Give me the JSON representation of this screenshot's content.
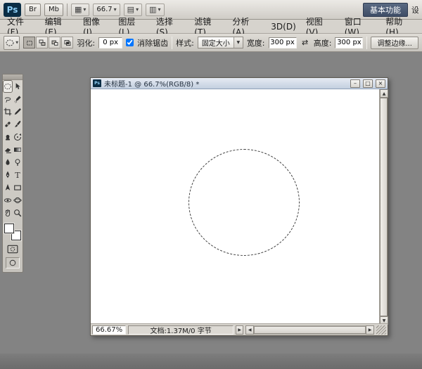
{
  "titlebar": {
    "logo": "Ps",
    "bridge": "Br",
    "mini_bridge": "Mb",
    "view_grid_icon": "▦",
    "zoom_value": "66.7",
    "arrange_icon": "▤",
    "screen_icon": "▥",
    "dropdown_icon": "▾",
    "workspace": "基本功能",
    "workspace_partial": "设"
  },
  "menubar": {
    "items": [
      "文件(F)",
      "编辑(E)",
      "图像(I)",
      "图层(L)",
      "选择(S)",
      "滤镜(T)",
      "分析(A)",
      "3D(D)",
      "视图(V)",
      "窗口(W)",
      "帮助(H)"
    ]
  },
  "options": {
    "tool_preset_dropdown": "▼",
    "feather_label": "羽化:",
    "feather_value": "0 px",
    "antialias_checked": true,
    "antialias_label": "消除锯齿",
    "style_label": "样式:",
    "style_value": "固定大小",
    "style_dropdown": "▼",
    "width_label": "宽度:",
    "width_value": "300 px",
    "swap_icon": "⇄",
    "height_label": "高度:",
    "height_value": "300 px",
    "refine_edge": "调整边缘..."
  },
  "toolbar": {
    "tools": [
      {
        "name": "elliptical-marquee-tool",
        "selected": true
      },
      {
        "name": "move-tool"
      },
      {
        "name": "lasso-tool"
      },
      {
        "name": "quick-selection-tool"
      },
      {
        "name": "crop-tool"
      },
      {
        "name": "eyedropper-tool"
      },
      {
        "name": "spot-healing-brush-tool"
      },
      {
        "name": "brush-tool"
      },
      {
        "name": "clone-stamp-tool"
      },
      {
        "name": "history-brush-tool"
      },
      {
        "name": "eraser-tool"
      },
      {
        "name": "gradient-tool"
      },
      {
        "name": "blur-tool"
      },
      {
        "name": "dodge-tool"
      },
      {
        "name": "pen-tool"
      },
      {
        "name": "type-tool"
      },
      {
        "name": "path-selection-tool"
      },
      {
        "name": "rectangle-tool"
      },
      {
        "name": "3d-rotate-tool"
      },
      {
        "name": "3d-orbit-tool"
      },
      {
        "name": "hand-tool"
      },
      {
        "name": "zoom-tool"
      }
    ],
    "foreground_color": "#ffffff",
    "background_color": "#ffffff"
  },
  "document": {
    "mini_logo": "Ps",
    "title": "未标题-1 @ 66.7%(RGB/8) *",
    "minimize_icon": "–",
    "maximize_icon": "□",
    "close_icon": "×",
    "status_zoom": "66.67%",
    "status_info": "文档:1.37M/0 字节",
    "status_popup_icon": "▶",
    "scroll_up_icon": "▲",
    "scroll_down_icon": "▼",
    "scroll_left_icon": "◀",
    "scroll_right_icon": "▶"
  }
}
